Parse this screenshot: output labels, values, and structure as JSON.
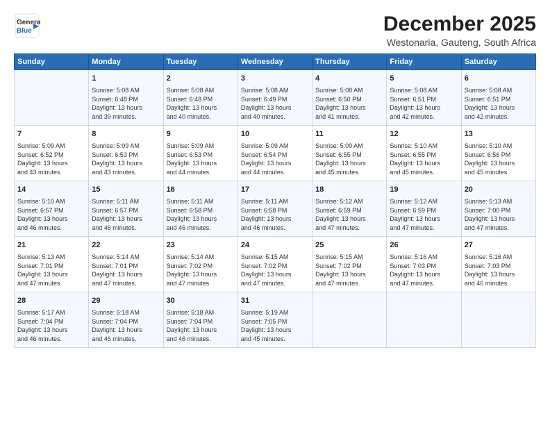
{
  "logo": {
    "line1": "General",
    "line2": "Blue",
    "icon": "▶"
  },
  "title": "December 2025",
  "subtitle": "Westonaria, Gauteng, South Africa",
  "days_header": [
    "Sunday",
    "Monday",
    "Tuesday",
    "Wednesday",
    "Thursday",
    "Friday",
    "Saturday"
  ],
  "weeks": [
    [
      {
        "day": "",
        "content": ""
      },
      {
        "day": "1",
        "content": "Sunrise: 5:08 AM\nSunset: 6:48 PM\nDaylight: 13 hours\nand 39 minutes."
      },
      {
        "day": "2",
        "content": "Sunrise: 5:08 AM\nSunset: 6:48 PM\nDaylight: 13 hours\nand 40 minutes."
      },
      {
        "day": "3",
        "content": "Sunrise: 5:08 AM\nSunset: 6:49 PM\nDaylight: 13 hours\nand 40 minutes."
      },
      {
        "day": "4",
        "content": "Sunrise: 5:08 AM\nSunset: 6:50 PM\nDaylight: 13 hours\nand 41 minutes."
      },
      {
        "day": "5",
        "content": "Sunrise: 5:08 AM\nSunset: 6:51 PM\nDaylight: 13 hours\nand 42 minutes."
      },
      {
        "day": "6",
        "content": "Sunrise: 5:08 AM\nSunset: 6:51 PM\nDaylight: 13 hours\nand 42 minutes."
      }
    ],
    [
      {
        "day": "7",
        "content": "Sunrise: 5:09 AM\nSunset: 6:52 PM\nDaylight: 13 hours\nand 43 minutes."
      },
      {
        "day": "8",
        "content": "Sunrise: 5:09 AM\nSunset: 6:53 PM\nDaylight: 13 hours\nand 43 minutes."
      },
      {
        "day": "9",
        "content": "Sunrise: 5:09 AM\nSunset: 6:53 PM\nDaylight: 13 hours\nand 44 minutes."
      },
      {
        "day": "10",
        "content": "Sunrise: 5:09 AM\nSunset: 6:54 PM\nDaylight: 13 hours\nand 44 minutes."
      },
      {
        "day": "11",
        "content": "Sunrise: 5:09 AM\nSunset: 6:55 PM\nDaylight: 13 hours\nand 45 minutes."
      },
      {
        "day": "12",
        "content": "Sunrise: 5:10 AM\nSunset: 6:55 PM\nDaylight: 13 hours\nand 45 minutes."
      },
      {
        "day": "13",
        "content": "Sunrise: 5:10 AM\nSunset: 6:56 PM\nDaylight: 13 hours\nand 45 minutes."
      }
    ],
    [
      {
        "day": "14",
        "content": "Sunrise: 5:10 AM\nSunset: 6:57 PM\nDaylight: 13 hours\nand 46 minutes."
      },
      {
        "day": "15",
        "content": "Sunrise: 5:11 AM\nSunset: 6:57 PM\nDaylight: 13 hours\nand 46 minutes."
      },
      {
        "day": "16",
        "content": "Sunrise: 5:11 AM\nSunset: 6:58 PM\nDaylight: 13 hours\nand 46 minutes."
      },
      {
        "day": "17",
        "content": "Sunrise: 5:11 AM\nSunset: 6:58 PM\nDaylight: 13 hours\nand 46 minutes."
      },
      {
        "day": "18",
        "content": "Sunrise: 5:12 AM\nSunset: 6:59 PM\nDaylight: 13 hours\nand 47 minutes."
      },
      {
        "day": "19",
        "content": "Sunrise: 5:12 AM\nSunset: 6:59 PM\nDaylight: 13 hours\nand 47 minutes."
      },
      {
        "day": "20",
        "content": "Sunrise: 5:13 AM\nSunset: 7:00 PM\nDaylight: 13 hours\nand 47 minutes."
      }
    ],
    [
      {
        "day": "21",
        "content": "Sunrise: 5:13 AM\nSunset: 7:01 PM\nDaylight: 13 hours\nand 47 minutes."
      },
      {
        "day": "22",
        "content": "Sunrise: 5:14 AM\nSunset: 7:01 PM\nDaylight: 13 hours\nand 47 minutes."
      },
      {
        "day": "23",
        "content": "Sunrise: 5:14 AM\nSunset: 7:02 PM\nDaylight: 13 hours\nand 47 minutes."
      },
      {
        "day": "24",
        "content": "Sunrise: 5:15 AM\nSunset: 7:02 PM\nDaylight: 13 hours\nand 47 minutes."
      },
      {
        "day": "25",
        "content": "Sunrise: 5:15 AM\nSunset: 7:02 PM\nDaylight: 13 hours\nand 47 minutes."
      },
      {
        "day": "26",
        "content": "Sunrise: 5:16 AM\nSunset: 7:03 PM\nDaylight: 13 hours\nand 47 minutes."
      },
      {
        "day": "27",
        "content": "Sunrise: 5:16 AM\nSunset: 7:03 PM\nDaylight: 13 hours\nand 46 minutes."
      }
    ],
    [
      {
        "day": "28",
        "content": "Sunrise: 5:17 AM\nSunset: 7:04 PM\nDaylight: 13 hours\nand 46 minutes."
      },
      {
        "day": "29",
        "content": "Sunrise: 5:18 AM\nSunset: 7:04 PM\nDaylight: 13 hours\nand 46 minutes."
      },
      {
        "day": "30",
        "content": "Sunrise: 5:18 AM\nSunset: 7:04 PM\nDaylight: 13 hours\nand 46 minutes."
      },
      {
        "day": "31",
        "content": "Sunrise: 5:19 AM\nSunset: 7:05 PM\nDaylight: 13 hours\nand 45 minutes."
      },
      {
        "day": "",
        "content": ""
      },
      {
        "day": "",
        "content": ""
      },
      {
        "day": "",
        "content": ""
      }
    ]
  ]
}
